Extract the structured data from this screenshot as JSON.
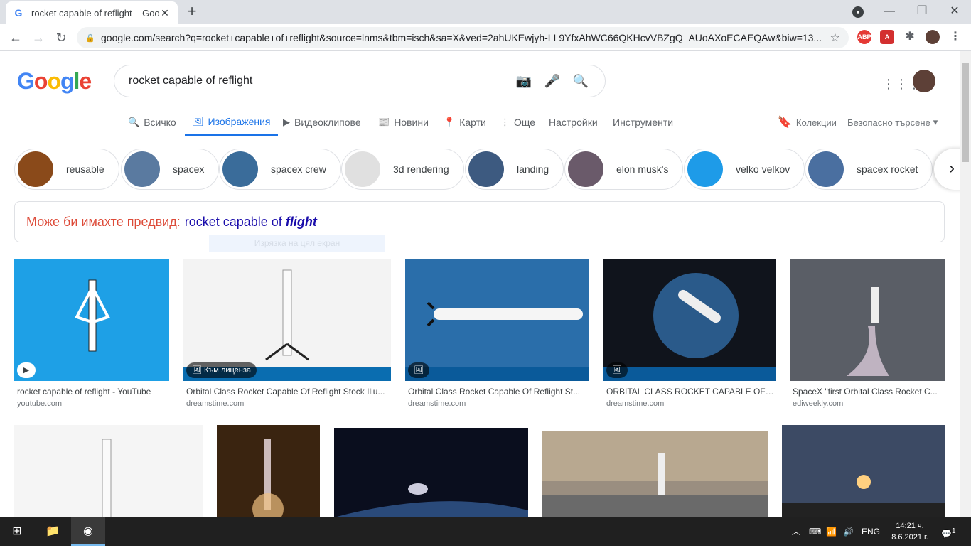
{
  "browser": {
    "tab_title": "rocket capable of reflight – Google",
    "tab_favicon": "G",
    "url": "google.com/search?q=rocket+capable+of+reflight&source=lnms&tbm=isch&sa=X&ved=2ahUKEwjyh-LL9YfxAhWC66QKHcvVBZgQ_AUoAXoECAEQAw&biw=13...",
    "ext_abp": "ABP",
    "ext_pdf": "A"
  },
  "google": {
    "logo": [
      "G",
      "o",
      "o",
      "g",
      "l",
      "e"
    ],
    "query": "rocket capable of reflight",
    "tabs": [
      {
        "icon": "🔍",
        "label": "Всичко"
      },
      {
        "icon": "🖼",
        "label": "Изображения"
      },
      {
        "icon": "▶",
        "label": "Видеоклипове"
      },
      {
        "icon": "📰",
        "label": "Новини"
      },
      {
        "icon": "📍",
        "label": "Карти"
      },
      {
        "icon": "⋮",
        "label": "Още"
      }
    ],
    "settings": "Настройки",
    "tools": "Инструменти",
    "collections": "Колекции",
    "safe_search": "Безопасно търсене"
  },
  "chips": [
    {
      "label": "reusable",
      "color": "#8a4a1a"
    },
    {
      "label": "spacex",
      "color": "#5a7aa0"
    },
    {
      "label": "spacex crew",
      "color": "#3a6c9a"
    },
    {
      "label": "3d rendering",
      "color": "#e0e0e0"
    },
    {
      "label": "landing",
      "color": "#3d5a80"
    },
    {
      "label": "elon musk's",
      "color": "#6a5a6a"
    },
    {
      "label": "velko velkov",
      "color": "#1e9be8"
    },
    {
      "label": "spacex rocket",
      "color": "#4a6fa0"
    }
  ],
  "did_you_mean": {
    "prefix": "Може би имахте предвид:",
    "suggestion": "rocket capable of",
    "emphasis": "flight",
    "ghost": "Изрязка на цял екран"
  },
  "results_row1": [
    {
      "caption": "rocket capable of reflight - YouTube",
      "source": "youtube.com",
      "badge": "▶",
      "bg": "#1ea0e6"
    },
    {
      "caption": "Orbital Class Rocket Capable Of Reflight Stock Illu...",
      "source": "dreamstime.com",
      "badge": "🖼 Към лиценза",
      "bg": "#f3f3f3"
    },
    {
      "caption": "Orbital Class Rocket Capable Of Reflight St...",
      "source": "dreamstime.com",
      "badge": "🖼",
      "bg": "#2a6eaa"
    },
    {
      "caption": "ORBITAL CLASS ROCKET CAPABLE OF R...",
      "source": "dreamstime.com",
      "badge": "🖼",
      "bg": "#10141c"
    },
    {
      "caption": "SpaceX \"first Orbital Class Rocket C...",
      "source": "ediweekly.com",
      "badge": "",
      "bg": "#5a5e66"
    }
  ],
  "results_row2": [
    {
      "bg": "#f5f5f5"
    },
    {
      "bg": "#3a2410"
    },
    {
      "bg": "#0a0e1e"
    },
    {
      "bg": "#9a8e80"
    },
    {
      "bg": "#3c4a64"
    }
  ],
  "taskbar": {
    "lang": "ENG",
    "time": "14:21 ч.",
    "date": "8.6.2021 г.",
    "notifications": "1"
  }
}
